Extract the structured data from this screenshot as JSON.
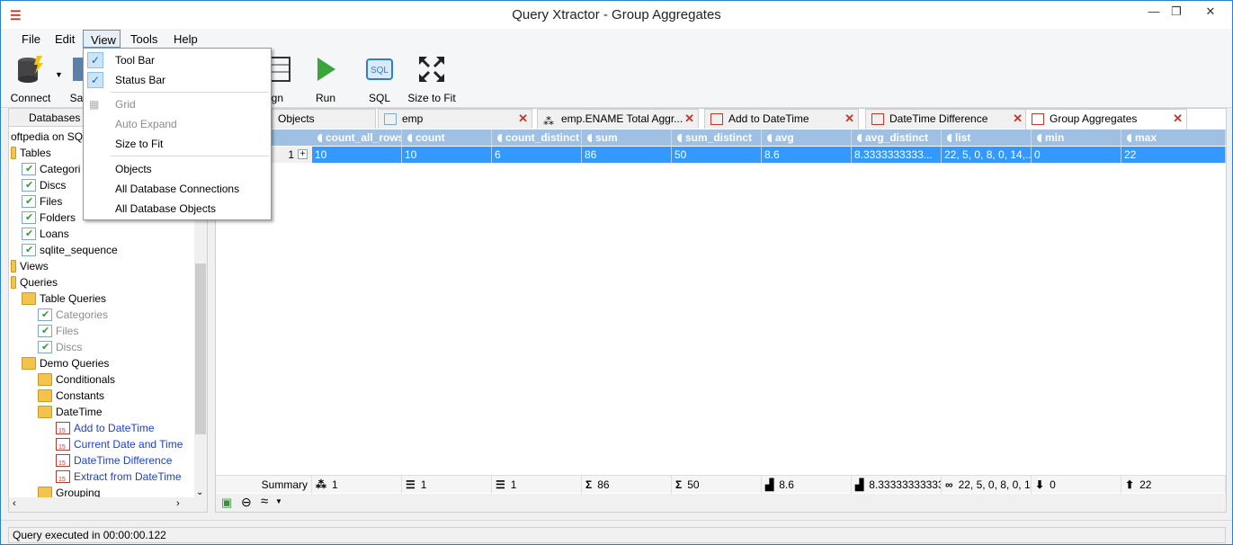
{
  "window": {
    "title": "Query Xtractor - Group Aggregates",
    "app_icon": "hamburger-icon"
  },
  "menu": [
    "File",
    "Edit",
    "View",
    "Tools",
    "Help"
  ],
  "toolbar": {
    "connect": "Connect",
    "save_partial": "Sa",
    "design_partial": "ign",
    "run": "Run",
    "sql": "SQL",
    "size_to_fit": "Size to Fit"
  },
  "view_menu": {
    "items": [
      {
        "label": "Tool Bar",
        "checked": true,
        "enabled": true
      },
      {
        "label": "Status Bar",
        "checked": true,
        "enabled": true
      },
      {
        "label": "Grid",
        "checked": false,
        "enabled": false
      },
      {
        "label": "Auto Expand",
        "checked": false,
        "enabled": false
      },
      {
        "label": "Size to Fit",
        "checked": false,
        "enabled": true
      },
      {
        "label": "Objects",
        "checked": false,
        "enabled": true
      },
      {
        "label": "All Database Connections",
        "checked": false,
        "enabled": true
      },
      {
        "label": "All Database Objects",
        "checked": false,
        "enabled": true
      }
    ]
  },
  "left_panel": {
    "tab": "Databases",
    "root": "oftpedia on SQ",
    "tree": [
      {
        "label": "Tables",
        "level": 0,
        "type": "folder"
      },
      {
        "label": "Categori",
        "level": 1,
        "type": "table"
      },
      {
        "label": "Discs",
        "level": 1,
        "type": "table"
      },
      {
        "label": "Files",
        "level": 1,
        "type": "table"
      },
      {
        "label": "Folders",
        "level": 1,
        "type": "table"
      },
      {
        "label": "Loans",
        "level": 1,
        "type": "table"
      },
      {
        "label": "sqlite_sequence",
        "level": 1,
        "type": "table"
      },
      {
        "label": "Views",
        "level": 0,
        "type": "folder"
      },
      {
        "label": "Queries",
        "level": 0,
        "type": "folder"
      },
      {
        "label": "Table Queries",
        "level": 1,
        "type": "folder"
      },
      {
        "label": "Categories",
        "level": 2,
        "type": "table-dim"
      },
      {
        "label": "Files",
        "level": 2,
        "type": "table-dim"
      },
      {
        "label": "Discs",
        "level": 2,
        "type": "table-dim"
      },
      {
        "label": "Demo Queries",
        "level": 1,
        "type": "folder"
      },
      {
        "label": "Conditionals",
        "level": 2,
        "type": "folder"
      },
      {
        "label": "Constants",
        "level": 2,
        "type": "folder"
      },
      {
        "label": "DateTime",
        "level": 2,
        "type": "folder"
      },
      {
        "label": "Add to DateTime",
        "level": 3,
        "type": "query"
      },
      {
        "label": "Current Date and Time",
        "level": 3,
        "type": "query"
      },
      {
        "label": "DateTime Difference",
        "level": 3,
        "type": "query"
      },
      {
        "label": "Extract from DateTime",
        "level": 3,
        "type": "query"
      },
      {
        "label": "Grouping",
        "level": 2,
        "type": "folder"
      }
    ]
  },
  "tabs": [
    {
      "label": "Objects",
      "closable": false
    },
    {
      "label": "emp",
      "closable": true
    },
    {
      "label": "emp.ENAME Total Aggr...",
      "closable": true
    },
    {
      "label": "Add to DateTime",
      "closable": true
    },
    {
      "label": "DateTime Difference",
      "closable": true
    },
    {
      "label": "Group Aggregates",
      "closable": true,
      "active": true
    }
  ],
  "grid": {
    "columns": [
      "count_all_rows",
      "count",
      "count_distinct",
      "sum",
      "sum_distinct",
      "avg",
      "avg_distinct",
      "list",
      "min",
      "max"
    ],
    "row_number": "1",
    "row": [
      "10",
      "10",
      "6",
      "86",
      "50",
      "8.6",
      "8.3333333333...",
      "22, 5, 0, 8, 0, 14,...",
      "0",
      "22"
    ],
    "summary_label": "Summary",
    "summary": [
      "1",
      "1",
      "1",
      "86",
      "50",
      "8.6",
      "8.33333333333",
      "22, 5, 0, 8, 0, 14",
      "0",
      "22"
    ],
    "summary_icons": [
      "⁂",
      "☰",
      "☰",
      "Σ",
      "Σ",
      "▟",
      "▟",
      "∞",
      "⬇",
      "⬆"
    ]
  },
  "status": {
    "text": "Query executed in 00:00:00.122"
  },
  "colors": {
    "header": "#9fc0e2",
    "selected_row": "#3399ff",
    "link_query": "#1a3fd6"
  }
}
